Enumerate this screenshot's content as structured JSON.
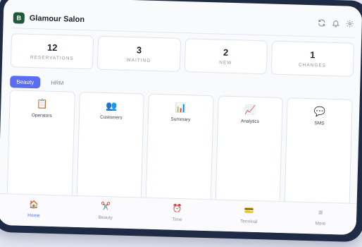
{
  "app": {
    "logo_letter": "B",
    "title": "Glamour Salon"
  },
  "header_icons": [
    "refresh-icon",
    "bell-icon",
    "gear-icon"
  ],
  "stats": [
    {
      "value": "12",
      "label": "RESERVATIONS"
    },
    {
      "value": "3",
      "label": "WAITING"
    },
    {
      "value": "2",
      "label": "NEW"
    },
    {
      "value": "1",
      "label": "CHANGES"
    }
  ],
  "tabs": [
    {
      "label": "Beauty",
      "active": true
    },
    {
      "label": "HRM",
      "active": false
    }
  ],
  "tiles": [
    {
      "icon": "📋",
      "label": "Operators"
    },
    {
      "icon": "👥",
      "label": "Customers"
    },
    {
      "icon": "📊",
      "label": "Summary"
    },
    {
      "icon": "📈",
      "label": "Analytics"
    },
    {
      "icon": "💬",
      "label": "SMS"
    }
  ],
  "nav": [
    {
      "icon": "🏠",
      "label": "Home",
      "active": true
    },
    {
      "icon": "✂️",
      "label": "Beauty",
      "active": false
    },
    {
      "icon": "⏰",
      "label": "Time",
      "active": false
    },
    {
      "icon": "💳",
      "label": "Terminal",
      "active": false
    },
    {
      "icon": "≡",
      "label": "More",
      "active": false
    }
  ],
  "colors": {
    "accent": "#5b6df2",
    "brand": "#1e5b3a",
    "frame": "#1f2a44"
  }
}
